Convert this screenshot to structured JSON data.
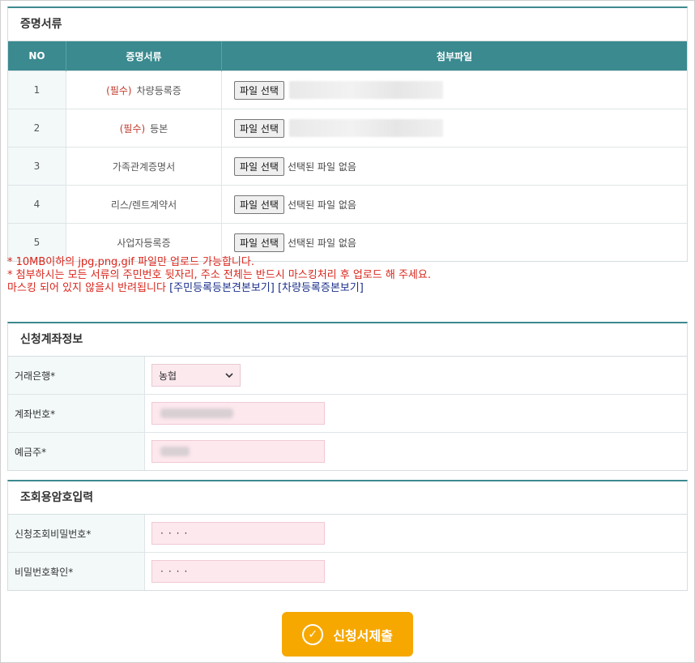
{
  "docs_section": {
    "title": "증명서류",
    "headers": [
      "NO",
      "증명서류",
      "첨부파일"
    ],
    "file_button_label": "파일 선택",
    "rows": [
      {
        "no": "1",
        "required": "(필수)",
        "name": "차량등록증",
        "status": ""
      },
      {
        "no": "2",
        "required": "(필수)",
        "name": "등본",
        "status": ""
      },
      {
        "no": "3",
        "required": "",
        "name": "가족관계증명서",
        "status": "선택된 파일 없음"
      },
      {
        "no": "4",
        "required": "",
        "name": "리스/렌트계약서",
        "status": "선택된 파일 없음"
      },
      {
        "no": "5",
        "required": "",
        "name": "사업자등록증",
        "status": "선택된 파일 없음"
      }
    ]
  },
  "notes": {
    "line1": "* 10MB이하의 jpg,png,gif 파일만 업로드 가능합니다.",
    "line2": "* 첨부하시는 모든 서류의 주민번호 뒷자리, 주소 전체는 반드시 마스킹처리 후 업로드 해 주세요.",
    "line3": "마스킹 되어 있지 않을시 반려됩니다",
    "link1": "[주민등록등본견본보기]",
    "link2": "[차량등록증본보기]"
  },
  "account_section": {
    "title": "신청계좌정보",
    "bank_label": "거래은행*",
    "bank_value": "농협",
    "account_label": "계좌번호*",
    "holder_label": "예금주*"
  },
  "password_section": {
    "title": "조회용암호입력",
    "pw_label": "신청조회비밀번호*",
    "pw_value": "····",
    "confirm_label": "비밀번호확인*",
    "confirm_value": "····"
  },
  "submit": {
    "label": "신청서제출",
    "icon": "check-circle-icon"
  }
}
